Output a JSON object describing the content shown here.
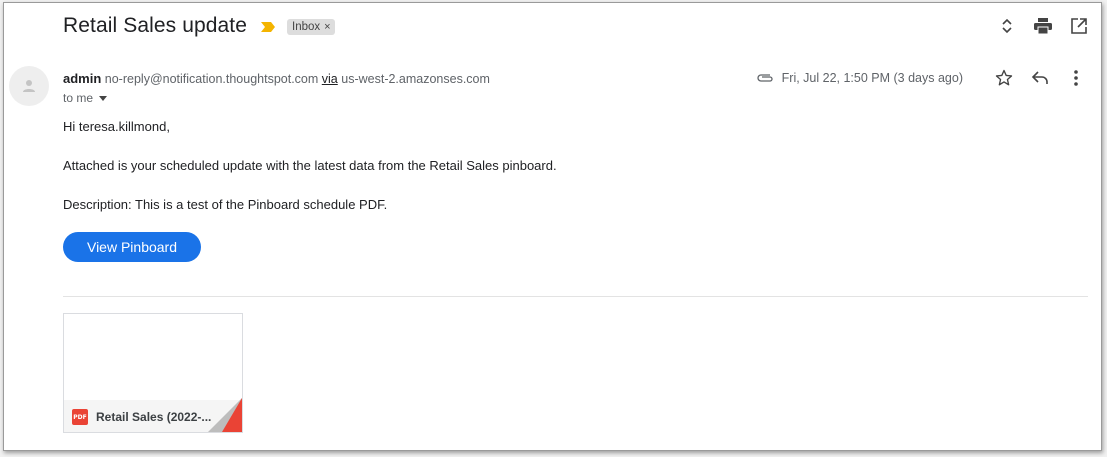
{
  "email": {
    "subject": "Retail Sales update",
    "label_chip": "Inbox",
    "label_chip_remove": "×",
    "sender": {
      "name": "admin",
      "address": "no-reply@notification.thoughtspot.com",
      "via_label": "via",
      "via_domain": "us-west-2.amazonses.com",
      "recipient_label": "to me"
    },
    "date": "Fri, Jul 22, 1:50 PM (3 days ago)",
    "body": {
      "greeting": "Hi teresa.killmond,",
      "line1": "Attached is your scheduled update with the latest data from the Retail Sales pinboard.",
      "line2": "Description: This is a test of the Pinboard schedule PDF."
    },
    "cta_button": "View Pinboard",
    "attachment": {
      "badge": "PDF",
      "name": "Retail Sales (2022-..."
    }
  },
  "icons": {
    "importance": "importance-marker-icon",
    "expand": "expand-collapse-icon",
    "print": "print-icon",
    "open_new_window": "open-in-new-window-icon",
    "attachment_clip": "paperclip-icon",
    "star": "star-icon",
    "reply": "reply-icon",
    "more": "more-vertical-icon",
    "avatar": "person-icon"
  },
  "colors": {
    "accent": "#1a73e8",
    "importance": "#f4b400",
    "pdf_red": "#ea4335"
  }
}
